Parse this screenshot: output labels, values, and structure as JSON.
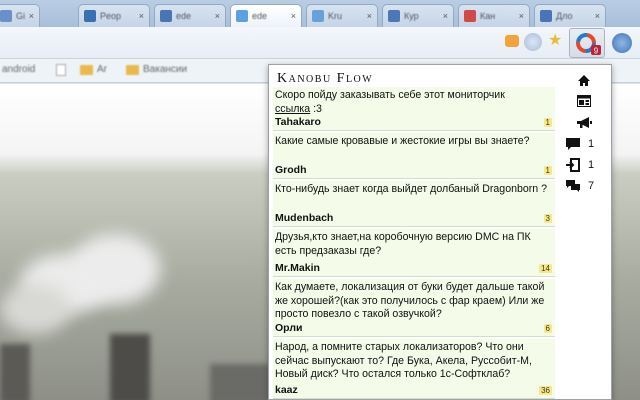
{
  "popup": {
    "title": "Kanobu Flow",
    "nav_icons": [
      "home-icon",
      "dashboard-icon",
      "megaphone-icon"
    ],
    "stats": [
      {
        "icon": "comment-icon",
        "value": "1"
      },
      {
        "icon": "exit-door-icon",
        "value": "1"
      },
      {
        "icon": "conversation-icon",
        "value": "7"
      }
    ],
    "items": [
      {
        "text": "Скоро пойду заказывать себе этот мониторчик ",
        "link": "ссылка",
        "suffix": " :3",
        "author": "Tahakaro",
        "count": "1"
      },
      {
        "text": "Какие самые кровавые и жестокие игры вы знаете?",
        "link": "",
        "suffix": "",
        "author": "Grodh",
        "count": "1"
      },
      {
        "text": "Кто-нибудь знает когда выйдет долбаный Dragonborn ?",
        "link": "",
        "suffix": "",
        "author": "Mudenbach",
        "count": "3"
      },
      {
        "text": "Друзья,кто знает,на коробочную версию DMC на ПК есть предзаказы где?",
        "link": "",
        "suffix": "",
        "author": "Mr.Makin",
        "count": "14"
      },
      {
        "text": "Как думаете, локализация от буки будет дальше такой же хорошей?(как это получилось с фар краем) Или же просто повезло с такой озвучкой?",
        "link": "",
        "suffix": "",
        "author": "Орли",
        "count": "6"
      },
      {
        "text": "Народ, а помните старых локализаторов? Что они сейчас выпускают то? Где Бука, Акела, Руссобит-М, Новый диск? Что остался только 1с-Софтклаб?",
        "link": "",
        "suffix": "",
        "author": "kaaz",
        "count": "36"
      }
    ]
  },
  "extension": {
    "badge_icon": "kanobu-flow-icon"
  },
  "colors": {
    "item_bg": "#f4fbe8",
    "count_badge": "#f7e98a",
    "popup_border": "#9aa3ad"
  }
}
